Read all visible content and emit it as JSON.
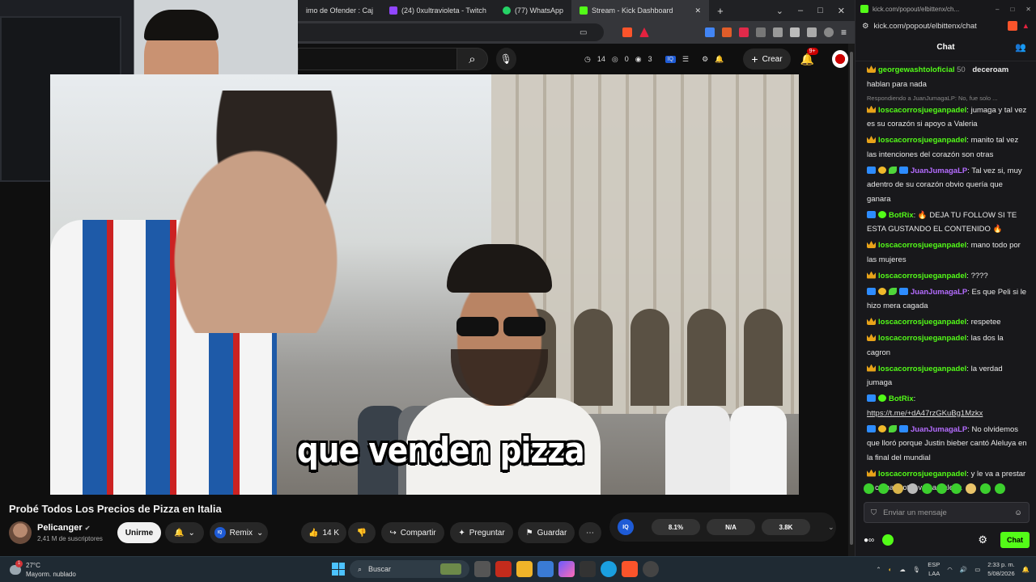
{
  "browser": {
    "tabs": [
      {
        "label": "imo de Ofender : Caj",
        "icon_color": "#888888"
      },
      {
        "label": "(24) 0xultravioleta - Twitch",
        "icon_color": "#9146ff"
      },
      {
        "label": "(77) WhatsApp",
        "icon_color": "#25d366"
      },
      {
        "label": "Stream - Kick Dashboard",
        "icon_color": "#53fc18"
      }
    ],
    "new_tab": "+",
    "window_controls": {
      "minimize": "–",
      "maximize": "□",
      "close": "✕"
    }
  },
  "youtube": {
    "header": {
      "stats": {
        "thumbs": "14",
        "eye": "0",
        "count": "3"
      },
      "crear_label": "Crear",
      "notif_badge": "9+"
    },
    "video": {
      "subtitle": "que venden pizza",
      "title": "Probé Todos Los Precios de Pizza en Italia"
    },
    "channel": {
      "name": "Pelicanger",
      "subscribers": "2,41 M de suscriptores",
      "join_label": "Unirme"
    },
    "actions": {
      "remix_label": "Remix",
      "likes": "14 K",
      "share_label": "Compartir",
      "ask_label": "Preguntar",
      "save_label": "Guardar",
      "more": "⋯"
    },
    "iq_panel": {
      "logo": "IQ",
      "values": [
        "8.1%",
        "N/A",
        "3.8K"
      ]
    }
  },
  "chat": {
    "window_url_small": "kick.com/popout/elbittenx/ch...",
    "url": "kick.com/popout/elbittenx/chat",
    "title": "Chat",
    "messages": [
      {
        "user": "georgewashtoloficial",
        "user_suffix": "50",
        "user2": "deceroam",
        "text": "hablan para nada",
        "color": "green",
        "badges": [
          "crown"
        ],
        "partial": true
      },
      {
        "reply": "Respondiendo a JuanJumagaLP: No, fue solo ...",
        "user": "loscacorrosjueganpadel",
        "text": "jumaga y tal vez es su corazón si apoyo a Valeria",
        "color": "green",
        "badges": [
          "crown"
        ]
      },
      {
        "user": "loscacorrosjueganpadel",
        "text": "manito tal vez las intenciones del corazón son otras",
        "color": "green",
        "badges": [
          "crown"
        ]
      },
      {
        "user": "JuanJumagaLP",
        "text": "Tal vez si, muy adentro de su corazón obvio quería que ganara",
        "color": "purple",
        "badges": [
          "blue",
          "gold",
          "leaf",
          "blue"
        ]
      },
      {
        "user": "BotRix",
        "text": "🔥 DEJA TU FOLLOW SI TE ESTA GUSTANDO EL CONTENIDO 🔥",
        "color": "green",
        "badges": [
          "blue",
          "check"
        ]
      },
      {
        "user": "loscacorrosjueganpadel",
        "text": "mano todo por las mujeres",
        "color": "green",
        "badges": [
          "crown"
        ]
      },
      {
        "user": "loscacorrosjueganpadel",
        "text": "????",
        "color": "green",
        "badges": [
          "crown"
        ]
      },
      {
        "user": "JuanJumagaLP",
        "text": "Es que Peli si le hizo mera cagada",
        "color": "purple",
        "badges": [
          "blue",
          "gold",
          "leaf",
          "blue"
        ]
      },
      {
        "user": "loscacorrosjueganpadel",
        "text": "respetee",
        "color": "green",
        "badges": [
          "crown"
        ]
      },
      {
        "user": "loscacorrosjueganpadel",
        "text": "las dos la cagron",
        "color": "green",
        "badges": [
          "crown"
        ]
      },
      {
        "user": "loscacorrosjueganpadel",
        "text": "la verdad jumaga",
        "color": "green",
        "badges": [
          "crown"
        ]
      },
      {
        "user": "BotRix",
        "text": "https://t.me/+dA47rzGKuBg1Mzkx",
        "color": "green",
        "badges": [
          "blue",
          "check"
        ],
        "is_link": true
      },
      {
        "user": "JuanJumagaLP",
        "text": "No olvidemos que lloró porque Justin bieber cantó Aleluya en la final del mundial",
        "color": "purple",
        "badges": [
          "blue",
          "gold",
          "leaf",
          "blue"
        ]
      },
      {
        "user": "loscacorrosjueganpadel",
        "text": "y le va a prestar el camaró otra vez a Valeria",
        "color": "green",
        "badges": [
          "crown"
        ]
      }
    ],
    "input_placeholder": "Enviar un mensaje",
    "send_label": "Chat"
  },
  "taskbar": {
    "weather_temp": "27°C",
    "weather_desc": "Mayorm. nublado",
    "weather_badge": "1",
    "search_label": "Buscar",
    "lang": "ESP",
    "lang2": "LAA",
    "time": "2:33 p. m.",
    "date": "5/08/2026"
  },
  "colors": {
    "kick_green": "#53fc18",
    "chat_bg": "#18181b",
    "yt_bg": "#0f0f0f",
    "iq_blue": "#1e5bd6"
  }
}
